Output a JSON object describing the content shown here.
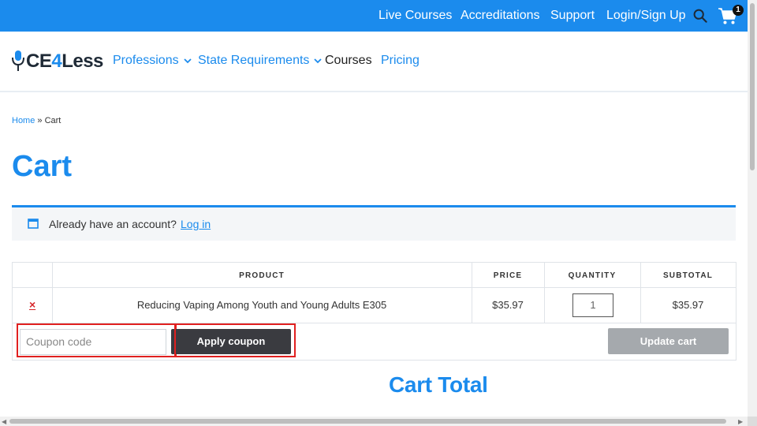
{
  "topbar": {
    "items": [
      "Live Courses",
      "Accreditations",
      "Support",
      "Login/Sign Up"
    ],
    "cart_count": "1",
    "search_icon": "search-icon",
    "cart_icon": "cart-icon",
    "background": "#1b8bed"
  },
  "header": {
    "logo_prefix": "CE",
    "logo_four": "4",
    "logo_suffix": "Less",
    "nav": [
      {
        "label": "Professions",
        "has_dropdown": true
      },
      {
        "label": "State Requirements",
        "has_dropdown": true
      },
      {
        "label": "Courses",
        "has_dropdown": false
      },
      {
        "label": "Pricing",
        "has_dropdown": false
      }
    ]
  },
  "breadcrumb": {
    "home": "Home",
    "separator": " » ",
    "current": "Cart"
  },
  "page_title": "Cart",
  "notice": {
    "text": "Already have an account?",
    "link": "Log in",
    "icon": "window-icon"
  },
  "cart_table": {
    "headers": [
      "PRODUCT",
      "PRICE",
      "QUANTITY",
      "SUBTOTAL"
    ],
    "rows": [
      {
        "remove": "×",
        "product": "Reducing Vaping Among Youth and Young Adults E305",
        "price": "$35.97",
        "quantity": "1",
        "subtotal": "$35.97"
      }
    ],
    "coupon_placeholder": "Coupon code",
    "apply_label": "Apply coupon",
    "update_label": "Update cart"
  },
  "cart_total_heading": "Cart Total",
  "colors": {
    "accent": "#1b8bed",
    "highlight": "#e02020",
    "dark_button": "#3a3b40",
    "disabled_button": "#a5a9ad"
  }
}
